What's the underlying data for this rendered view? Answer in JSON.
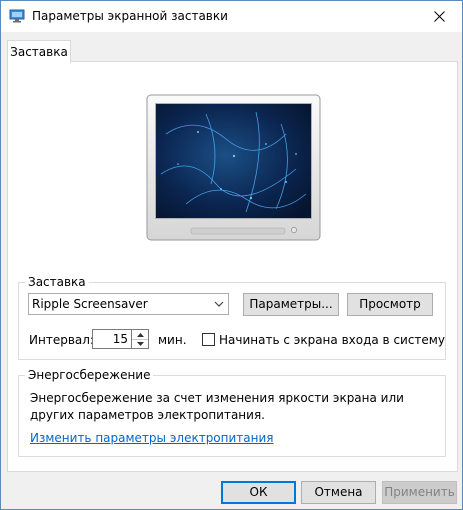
{
  "window": {
    "title": "Параметры экранной заставки"
  },
  "tabs": [
    {
      "label": "Заставка"
    }
  ],
  "screensaver_group": {
    "title": "Заставка",
    "selected": "Ripple Screensaver",
    "settings_label": "Параметры...",
    "preview_label": "Просмотр",
    "interval_label": "Интервал:",
    "interval_value": "15",
    "interval_unit": "мин.",
    "logon_checkbox_label": "Начинать с экрана входа в систему",
    "logon_checked": false
  },
  "energy_group": {
    "title": "Энергосбережение",
    "description": "Энергосбережение за счет изменения яркости экрана или других параметров электропитания.",
    "link": "Изменить параметры электропитания"
  },
  "footer": {
    "ok_label": "ОК",
    "cancel_label": "Отмена",
    "apply_label": "Применить"
  },
  "colors": {
    "accent": "#0078d7",
    "link": "#0066cc",
    "preview_bg": "#0a1a3a"
  }
}
